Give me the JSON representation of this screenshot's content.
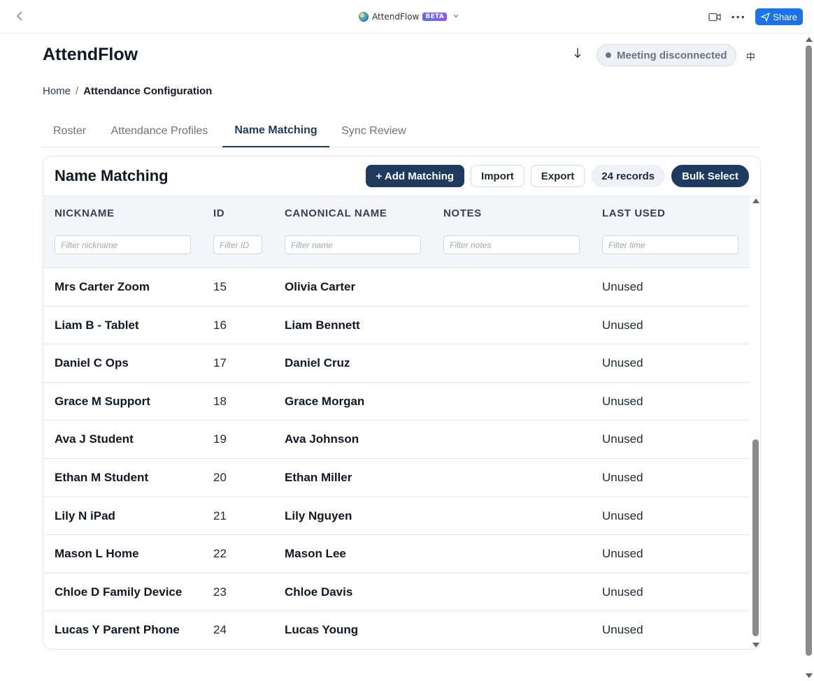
{
  "window": {
    "app_name": "AttendFlow",
    "beta_badge": "BETA",
    "share_label": "Share"
  },
  "header": {
    "title": "AttendFlow",
    "meeting_status": "Meeting disconnected",
    "lang_toggle": "中"
  },
  "breadcrumb": {
    "home": "Home",
    "separator": "/",
    "current": "Attendance Configuration"
  },
  "tabs": [
    {
      "label": "Roster",
      "active": false
    },
    {
      "label": "Attendance Profiles",
      "active": false
    },
    {
      "label": "Name Matching",
      "active": true
    },
    {
      "label": "Sync Review",
      "active": false
    }
  ],
  "card": {
    "title": "Name Matching",
    "add_label": "+ Add Matching",
    "import_label": "Import",
    "export_label": "Export",
    "records_label": "24 records",
    "bulk_label": "Bulk Select"
  },
  "table": {
    "columns": [
      "NICKNAME",
      "ID",
      "CANONICAL NAME",
      "NOTES",
      "LAST USED"
    ],
    "filters": [
      "Filter nickname",
      "Filter ID",
      "Filter name",
      "Filter notes",
      "Filter time"
    ],
    "rows": [
      {
        "nickname": "Mrs Carter Zoom",
        "id": "15",
        "canonical": "Olivia Carter",
        "notes": "",
        "last_used": "Unused"
      },
      {
        "nickname": "Liam B - Tablet",
        "id": "16",
        "canonical": "Liam Bennett",
        "notes": "",
        "last_used": "Unused"
      },
      {
        "nickname": "Daniel C Ops",
        "id": "17",
        "canonical": "Daniel Cruz",
        "notes": "",
        "last_used": "Unused"
      },
      {
        "nickname": "Grace M Support",
        "id": "18",
        "canonical": "Grace Morgan",
        "notes": "",
        "last_used": "Unused"
      },
      {
        "nickname": "Ava J Student",
        "id": "19",
        "canonical": "Ava Johnson",
        "notes": "",
        "last_used": "Unused"
      },
      {
        "nickname": "Ethan M Student",
        "id": "20",
        "canonical": "Ethan Miller",
        "notes": "",
        "last_used": "Unused"
      },
      {
        "nickname": "Lily N iPad",
        "id": "21",
        "canonical": "Lily Nguyen",
        "notes": "",
        "last_used": "Unused"
      },
      {
        "nickname": "Mason L Home",
        "id": "22",
        "canonical": "Mason Lee",
        "notes": "",
        "last_used": "Unused"
      },
      {
        "nickname": "Chloe D Family Device",
        "id": "23",
        "canonical": "Chloe Davis",
        "notes": "",
        "last_used": "Unused"
      },
      {
        "nickname": "Lucas Y Parent Phone",
        "id": "24",
        "canonical": "Lucas Young",
        "notes": "",
        "last_used": "Unused"
      }
    ]
  },
  "icons": {
    "back": "chevron-left-icon",
    "globe": "globe-icon",
    "dropdown": "chevron-down-icon",
    "camera": "video-camera-icon",
    "more": "more-horizontal-icon",
    "share": "send-icon",
    "download": "download-arrow-icon"
  },
  "colors": {
    "primary": "#1e3a5f",
    "share_blue": "#1a73e8",
    "beta_gradient_start": "#5b6cf0",
    "pill_bg": "#eef1f7"
  }
}
